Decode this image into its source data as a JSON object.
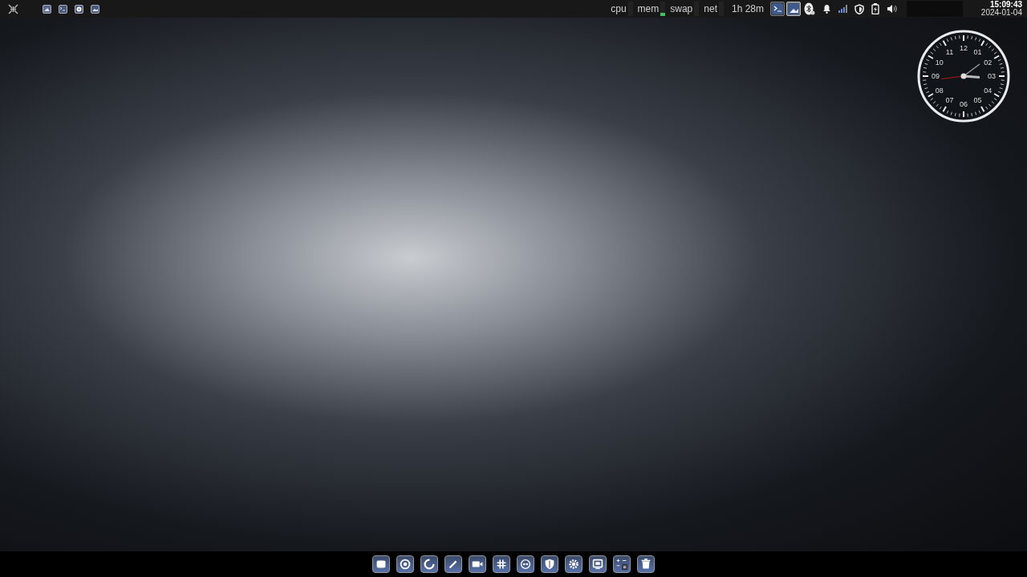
{
  "top_bar": {
    "monitors": [
      {
        "label": "cpu",
        "level": 0
      },
      {
        "label": "mem",
        "level": 0.2
      },
      {
        "label": "swap",
        "level": 0
      },
      {
        "label": "net",
        "level": 0
      }
    ],
    "uptime": "1h 28m",
    "tasks": [
      {
        "selected": false
      },
      {
        "selected": true
      }
    ],
    "clock": {
      "time": "15:09:43",
      "date": "2024-01-04"
    }
  },
  "clock_widget": {
    "numbers": [
      "12",
      "01",
      "02",
      "03",
      "04",
      "05",
      "06",
      "07",
      "08",
      "09",
      "10",
      "11"
    ]
  }
}
